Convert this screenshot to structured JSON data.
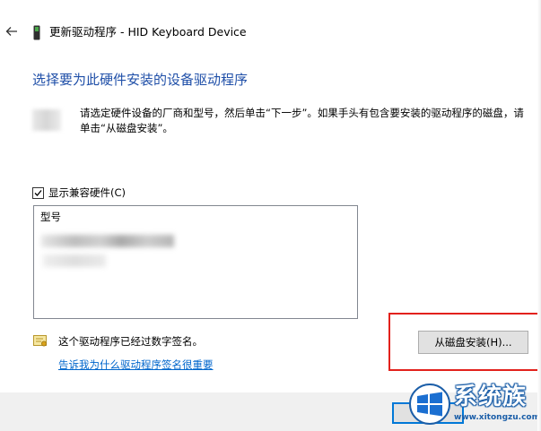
{
  "window": {
    "title": "更新驱动程序 - HID Keyboard Device",
    "back_icon": "back-arrow-icon",
    "device_icon": "device-icon"
  },
  "main": {
    "heading": "选择要为此硬件安装的设备驱动程序",
    "instructions": "请选定硬件设备的厂商和型号，然后单击“下一步”。如果手头有包含要安装的驱动程序的磁盘，请单击“从磁盘安装”。",
    "show_compatible": {
      "label": "显示兼容硬件(C)",
      "checked": true
    },
    "model_list": {
      "header": "型号"
    },
    "signed_text": "这个驱动程序已经过数字签名。",
    "signed_link": "告诉我为什么驱动程序签名很重要",
    "disk_button": "从磁盘安装(H)..."
  },
  "watermark": {
    "title": "系统族",
    "url": "www.xitongzu.com"
  },
  "colors": {
    "heading": "#1f4fa8",
    "link": "#0066cc",
    "highlight": "#e2211c",
    "focus": "#0078d7"
  }
}
